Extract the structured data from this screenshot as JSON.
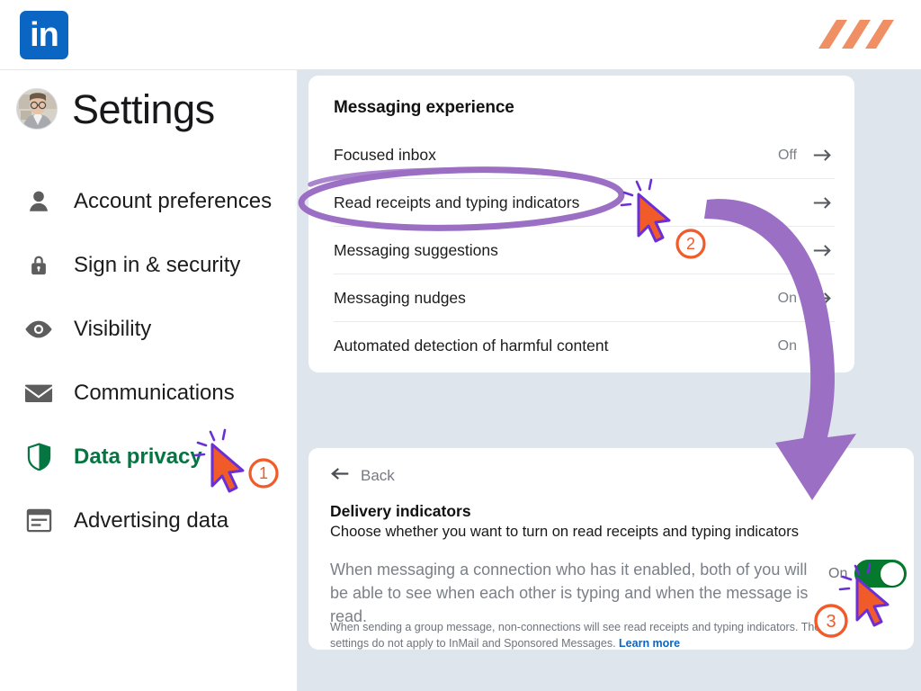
{
  "app": {
    "brand": "LinkedIn",
    "logo_text": "in",
    "logo_color": "#0a66c2",
    "brandmark_color": "#ef8354",
    "brandmark_icon": "three-slash-brandmark"
  },
  "sidebar": {
    "title": "Settings",
    "avatar_icon": "user-avatar-photo",
    "items": [
      {
        "label": "Account preferences",
        "icon": "person-icon",
        "active": false
      },
      {
        "label": "Sign in & security",
        "icon": "lock-icon",
        "active": false
      },
      {
        "label": "Visibility",
        "icon": "eye-icon",
        "active": false
      },
      {
        "label": "Communications",
        "icon": "envelope-icon",
        "active": false
      },
      {
        "label": "Data privacy",
        "icon": "shield-icon",
        "active": true
      },
      {
        "label": "Advertising data",
        "icon": "document-icon",
        "active": false
      }
    ],
    "active_color": "#057642"
  },
  "messaging_card": {
    "title": "Messaging experience",
    "rows": [
      {
        "label": "Focused inbox",
        "status": "Off",
        "arrow": "arrow-right-icon"
      },
      {
        "label": "Read receipts and typing indicators",
        "status": "",
        "arrow": "arrow-right-icon"
      },
      {
        "label": "Messaging suggestions",
        "status": "",
        "arrow": "arrow-right-icon"
      },
      {
        "label": "Messaging nudges",
        "status": "On",
        "arrow": "arrow-right-icon"
      },
      {
        "label": "Automated detection of harmful content",
        "status": "On",
        "arrow": "arrow-right-icon"
      }
    ]
  },
  "delivery_panel": {
    "back_label": "Back",
    "back_icon": "arrow-left-icon",
    "title": "Delivery indicators",
    "subtitle": "Choose whether you want to turn on read receipts and typing indicators",
    "body": "When messaging a connection who has it enabled, both of you will be able to see when each other is typing and when the message is read.",
    "fine_print": "When sending a group message, non-connections will see read receipts and typing indicators. These settings do not apply to InMail and Sponsored Messages.",
    "learn_more": "Learn more",
    "toggle_label": "On",
    "toggle_state": "on",
    "toggle_on_color": "#057a2f"
  },
  "annotations": {
    "accent_purple": "#9b6fc4",
    "badge_orange": "#f15a29",
    "cursor_fill": "#f15a29",
    "cursor_outline": "#6b2fd6",
    "steps": [
      {
        "number": "1",
        "target": "Data privacy"
      },
      {
        "number": "2",
        "target": "Read receipts and typing indicators"
      },
      {
        "number": "3",
        "target": "delivery-indicators-toggle"
      }
    ],
    "ellipse_target": "Read receipts and typing indicators",
    "arrow_shape": "curved-down-arrow"
  }
}
